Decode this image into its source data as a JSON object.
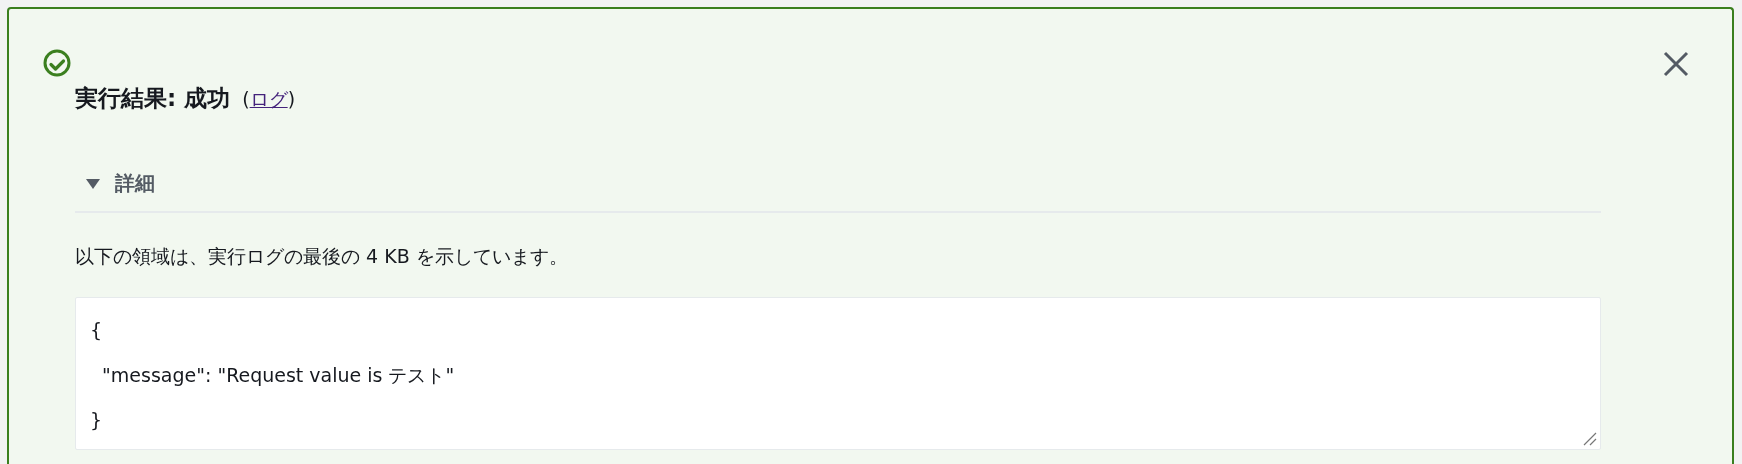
{
  "alert": {
    "kind": "success",
    "title": "実行結果: 成功",
    "link_open": "(",
    "link": "ログ",
    "link_close": ")",
    "details": {
      "label": "詳細",
      "expanded": true,
      "description": "以下の領域は、実行ログの最後の 4 KB を示しています。",
      "output": {
        "lines": [
          "{",
          "  \"message\": \"Request value is テスト\"",
          "}"
        ]
      }
    }
  }
}
